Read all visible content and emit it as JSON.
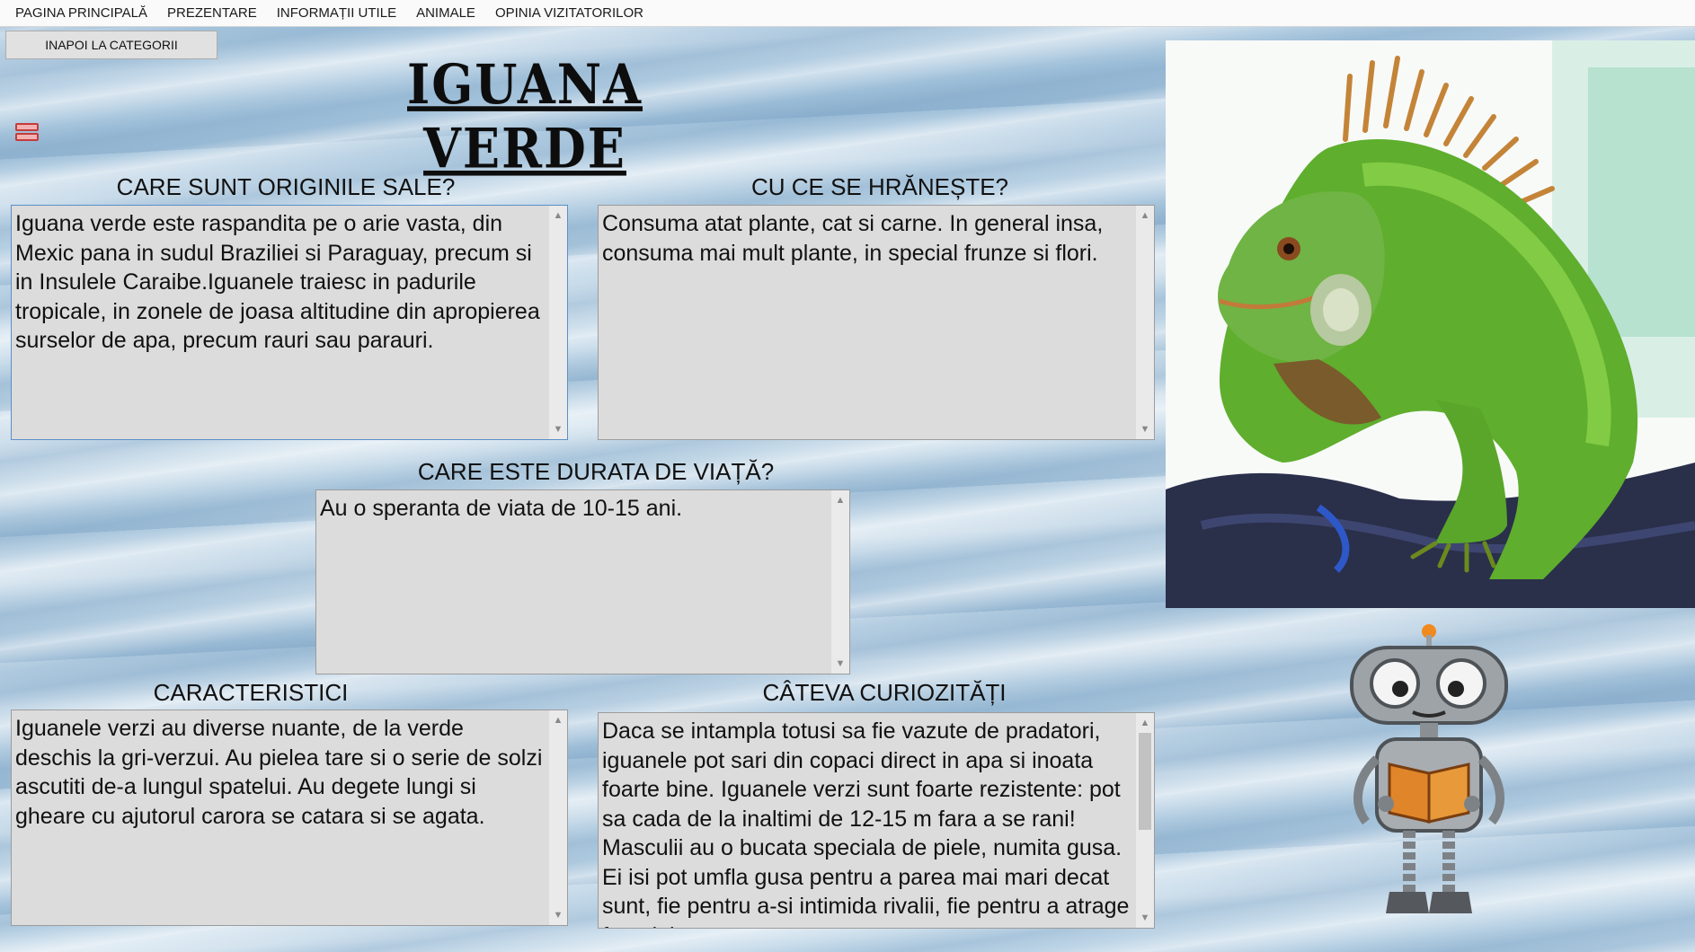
{
  "menu": {
    "items": [
      "PAGINA PRINCIPALĂ",
      "PREZENTARE",
      "INFORMAȚII UTILE",
      "ANIMALE",
      "OPINIA VIZITATORILOR"
    ]
  },
  "back_button": "INAPOI LA CATEGORII",
  "title": "IGUANA VERDE",
  "sections": {
    "origins": {
      "heading": "CARE SUNT ORIGINILE SALE?",
      "text": "Iguana verde este raspandita pe o arie vasta, din Mexic pana in sudul Braziliei si Paraguay, precum si in Insulele Caraibe.Iguanele traiesc in padurile tropicale, in zonele de joasa altitudine din apropierea surselor de apa, precum rauri sau parauri."
    },
    "diet": {
      "heading": "CU CE SE HRĂNEȘTE?",
      "text": "Consuma atat plante, cat si carne. In general insa, consuma mai mult plante, in special frunze si flori."
    },
    "lifespan": {
      "heading": "CARE ESTE DURATA DE VIAȚĂ?",
      "text": "Au o speranta de viata de 10-15 ani."
    },
    "traits": {
      "heading": "CARACTERISTICI",
      "text": "Iguanele verzi au diverse nuante, de la verde deschis la gri-verzui. Au pielea tare si o serie de solzi ascutiti de-a lungul spatelui. Au degete lungi si gheare cu ajutorul carora se catara si se agata."
    },
    "curiosities": {
      "heading": "CÂTEVA CURIOZITĂȚI",
      "text": "Daca se intampla totusi sa fie vazute de pradatori, iguanele pot sari din copaci direct in apa si inoata foarte bine. Iguanele verzi sunt foarte rezistente: pot sa cada de la inaltimi de 12-15 m fara a se rani! Masculii au o bucata speciala de piele, numita gusa. Ei isi pot umfla gusa pentru a parea mai mari decat sunt, fie pentru a-si intimida rivalii, fie pentru a atrage femelele."
    }
  },
  "icons": {
    "menu": "menu-stack-icon",
    "scroll_up": "scroll-up-icon",
    "scroll_down": "scroll-down-icon"
  },
  "images": {
    "photo": "green-iguana-photo",
    "mascot": "robot-reading-book-mascot"
  }
}
